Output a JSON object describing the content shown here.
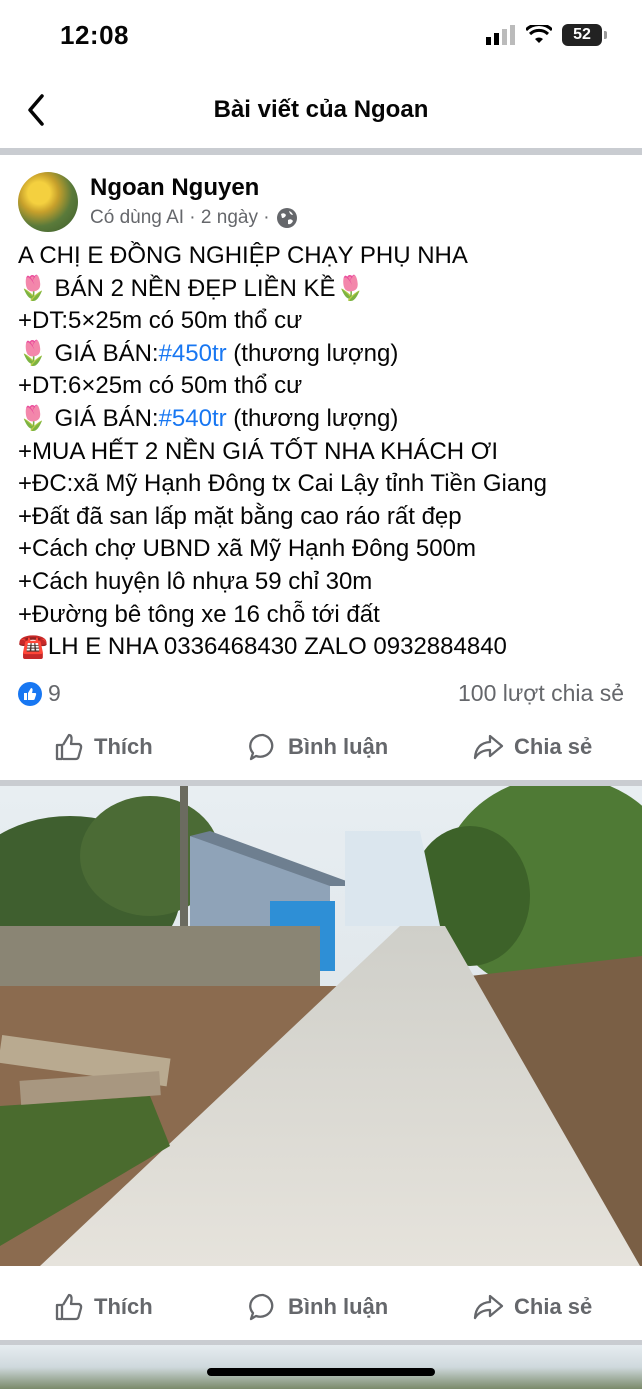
{
  "status_bar": {
    "time": "12:08",
    "battery": "52"
  },
  "nav": {
    "title": "Bài viết của Ngoan"
  },
  "post": {
    "author": "Ngoan Nguyen",
    "meta": "Có dùng AI · 2 ngày ·",
    "lines": [
      {
        "pre": "A CHỊ E ĐỒNG NGHIỆP CHẠY PHỤ NHA",
        "tag": "",
        "post": ""
      },
      {
        "pre": "🌷 BÁN 2 NỀN ĐẸP LIỀN KỀ🌷",
        "tag": "",
        "post": ""
      },
      {
        "pre": "+DT:5×25m có 50m thổ cư",
        "tag": "",
        "post": ""
      },
      {
        "pre": "🌷 GIÁ BÁN:",
        "tag": "#450tr",
        "post": " (thương lượng)"
      },
      {
        "pre": "+DT:6×25m có 50m thổ cư",
        "tag": "",
        "post": ""
      },
      {
        "pre": "🌷 GIÁ BÁN:",
        "tag": "#540tr",
        "post": " (thương lượng)"
      },
      {
        "pre": "+MUA HẾT 2 NỀN GIÁ TỐT NHA KHÁCH ƠI",
        "tag": "",
        "post": ""
      },
      {
        "pre": "+ĐC:xã Mỹ Hạnh Đông tx Cai Lậy tỉnh Tiền Giang",
        "tag": "",
        "post": ""
      },
      {
        "pre": "+Đất đã san lấp mặt bằng cao ráo rất đẹp",
        "tag": "",
        "post": ""
      },
      {
        "pre": "+Cách chợ UBND xã Mỹ Hạnh Đông 500m",
        "tag": "",
        "post": ""
      },
      {
        "pre": "+Cách huyện lô nhựa 59 chỉ 30m",
        "tag": "",
        "post": ""
      },
      {
        "pre": "+Đường bê tông xe 16 chỗ tới đất",
        "tag": "",
        "post": ""
      },
      {
        "pre": "☎️LH E NHA 0336468430 ZALO 0932884840",
        "tag": "",
        "post": ""
      }
    ],
    "like_count": "9",
    "shares": "100 lượt chia sẻ"
  },
  "actions": {
    "like": "Thích",
    "comment": "Bình luận",
    "share": "Chia sẻ"
  },
  "colors": {
    "accent": "#1877f2",
    "secondary_text": "#65676b"
  },
  "icons": [
    "back-chevron-icon",
    "signal-icon",
    "wifi-icon",
    "battery-icon",
    "globe-icon",
    "like-reaction-icon",
    "thumbs-up-icon",
    "comment-icon",
    "share-icon"
  ]
}
